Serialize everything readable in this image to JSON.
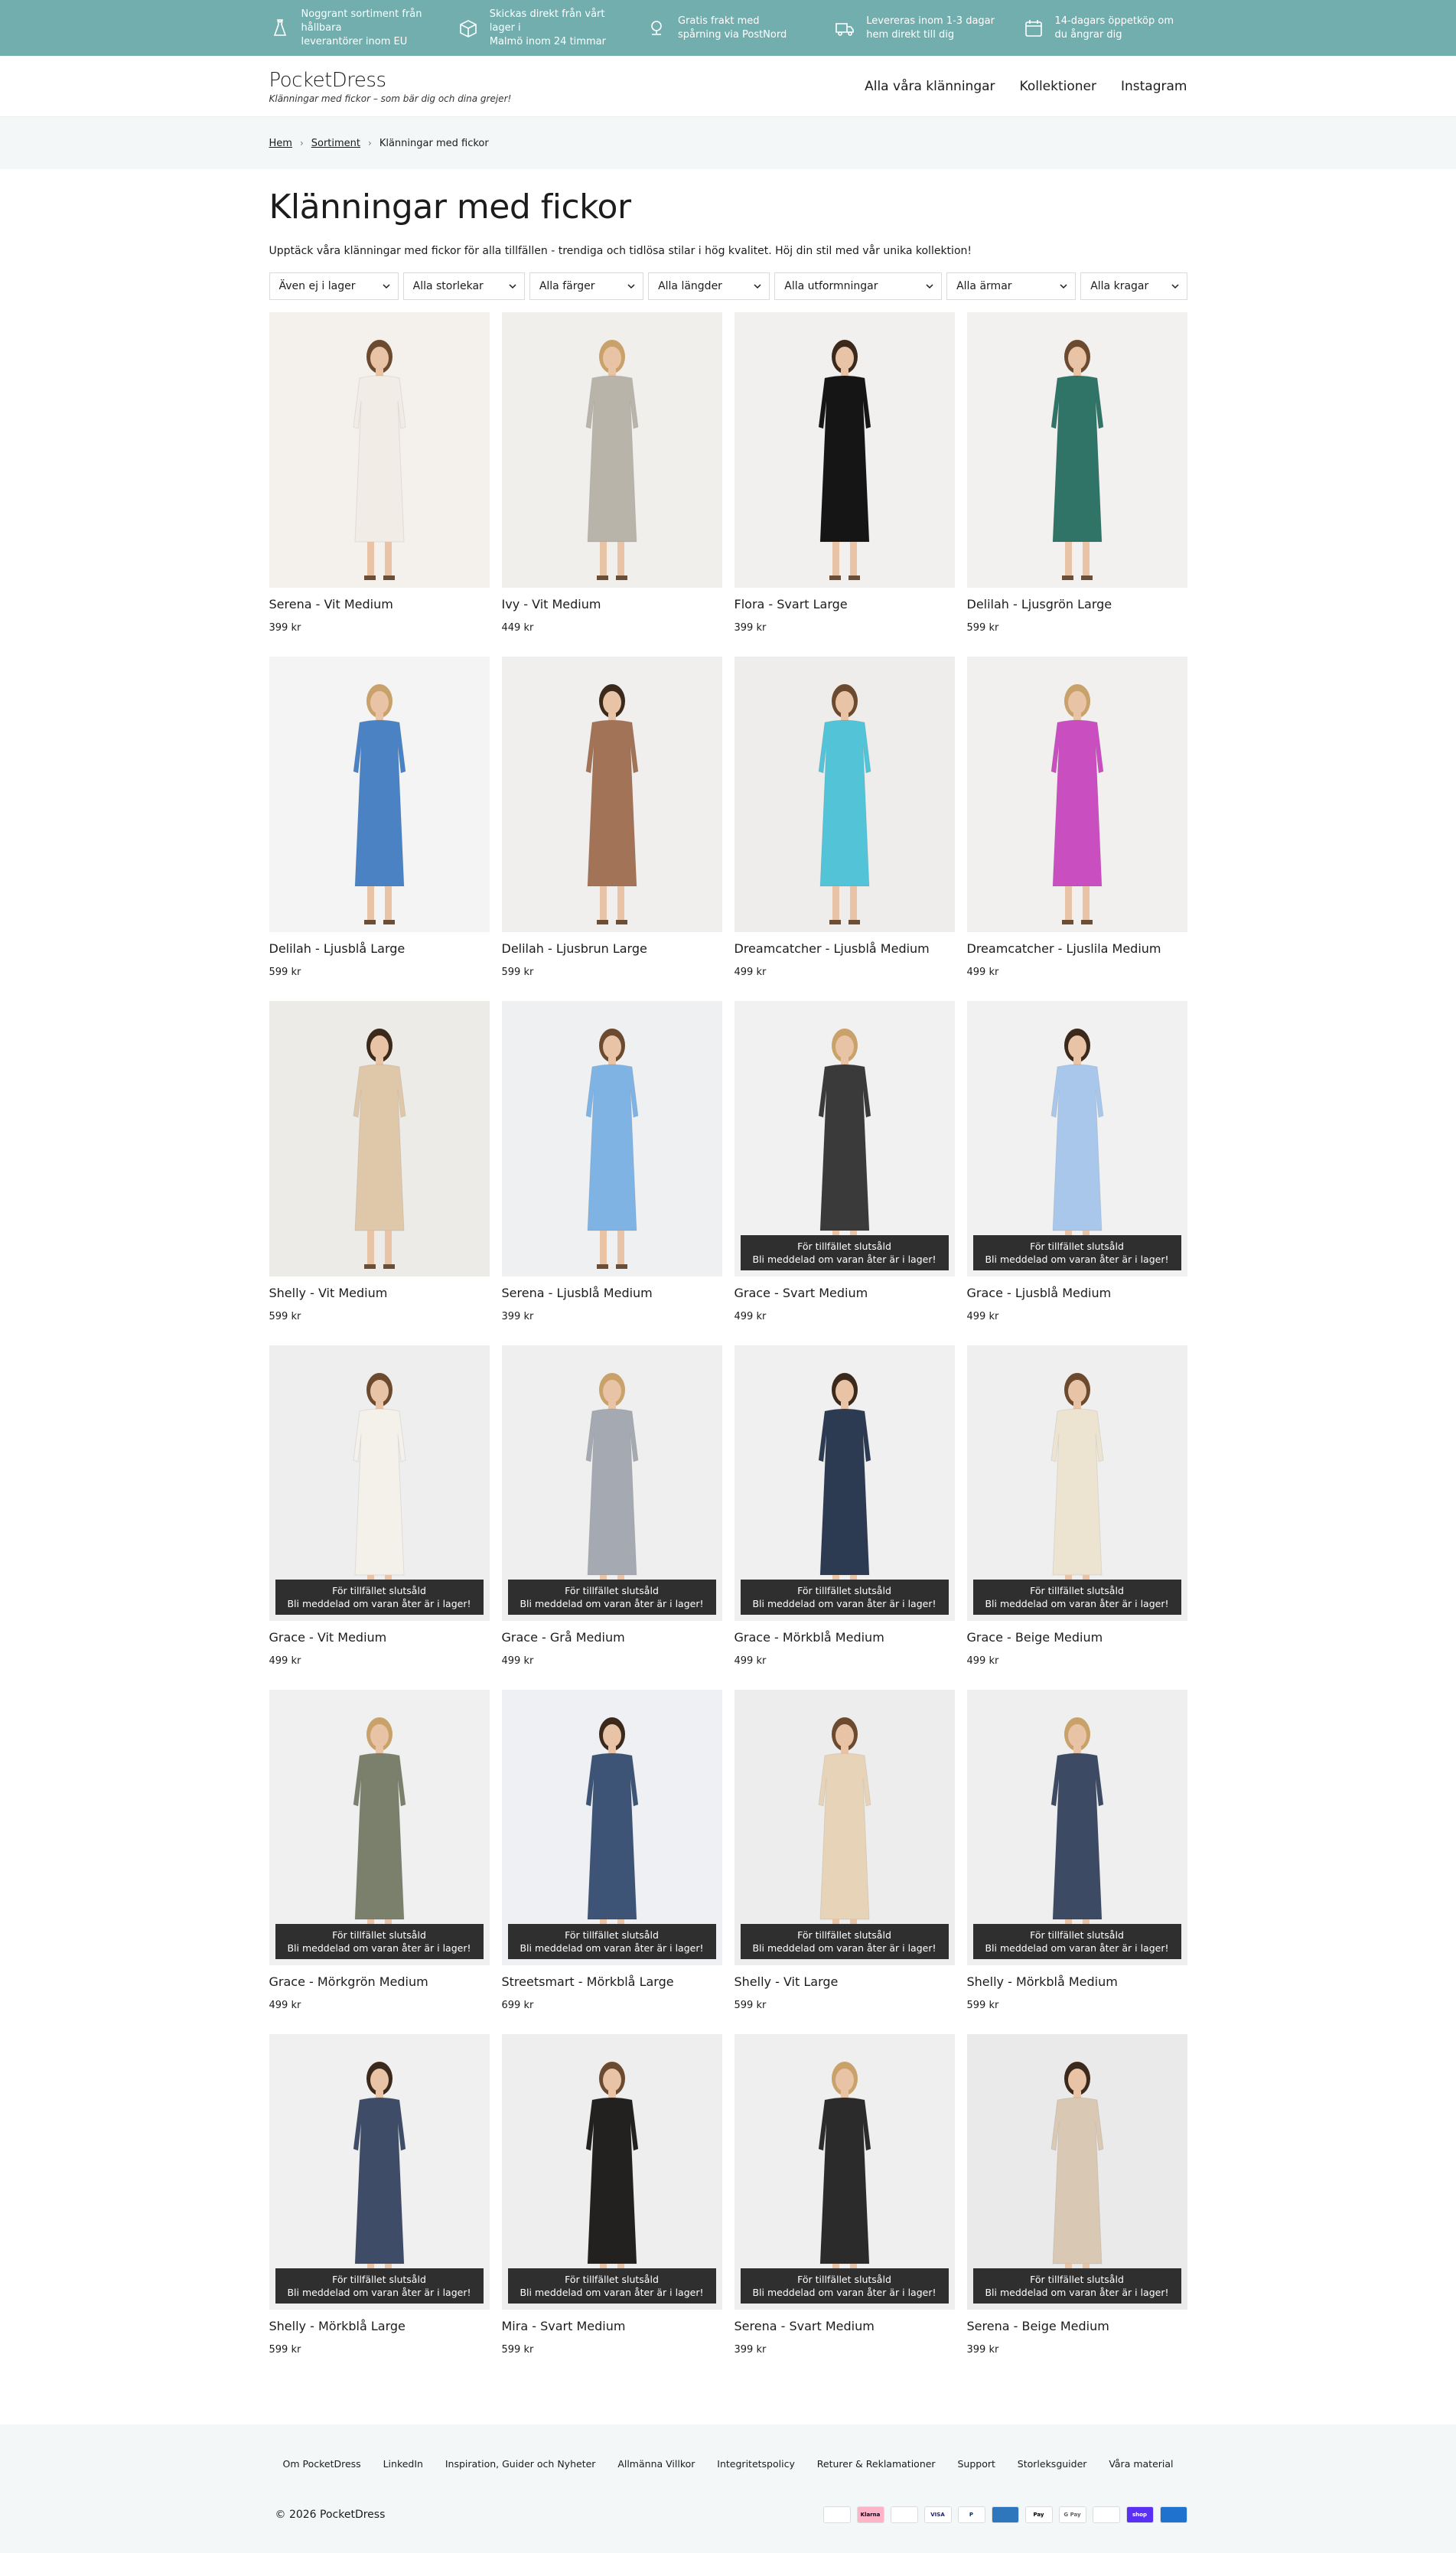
{
  "usps": [
    {
      "icon": "dress-icon",
      "text": "Noggrant sortiment från hållbara\nleverantörer inom EU"
    },
    {
      "icon": "box-icon",
      "text": "Skickas direkt från vårt lager i\nMalmö inom 24 timmar"
    },
    {
      "icon": "location-pin-icon",
      "text": "Gratis frakt med\nspårning via PostNord"
    },
    {
      "icon": "truck-icon",
      "text": "Levereras inom 1-3 dagar\nhem direkt till dig"
    },
    {
      "icon": "calendar-icon",
      "text": "14-dagars öppetköp om\ndu ångrar dig"
    }
  ],
  "header": {
    "logo": "PocketDress",
    "tagline": "Klänningar med fickor – som bär dig och dina grejer!",
    "nav": [
      "Alla våra klänningar",
      "Kollektioner",
      "Instagram"
    ]
  },
  "breadcrumb": [
    "Hem",
    "Sortiment",
    "Klänningar med fickor"
  ],
  "page": {
    "title": "Klänningar med fickor",
    "description": "Upptäck våra klänningar med fickor för alla tillfällen - trendiga och tidlösa stilar i hög kvalitet. Höj din stil med vår unika kollektion!"
  },
  "filters": [
    "Även ej i lager",
    "Alla storlekar",
    "Alla färger",
    "Alla längder",
    "Alla utformningar",
    "Alla ärmar",
    "Alla kragar"
  ],
  "soldout": {
    "line1": "För tillfället slutsåld",
    "line2": "Bli meddelad om varan åter är i lager!"
  },
  "products": [
    {
      "name": "Serena - Vit Medium",
      "price": "399 kr",
      "soldout": false,
      "color": "#f1ede6",
      "bg": "#f4f1ec"
    },
    {
      "name": "Ivy - Vit Medium",
      "price": "449 kr",
      "soldout": false,
      "color": "#b8b4aa",
      "bg": "#f0efec"
    },
    {
      "name": "Flora - Svart Large",
      "price": "399 kr",
      "soldout": false,
      "color": "#151515",
      "bg": "#f2f0ee"
    },
    {
      "name": "Delilah - Ljusgrön Large",
      "price": "599 kr",
      "soldout": false,
      "color": "#2f7467",
      "bg": "#f3f1ef"
    },
    {
      "name": "Delilah - Ljusblå Large",
      "price": "599 kr",
      "soldout": false,
      "color": "#4b82c4",
      "bg": "#f4f4f4"
    },
    {
      "name": "Delilah - Ljusbrun Large",
      "price": "599 kr",
      "soldout": false,
      "color": "#a27356",
      "bg": "#f1efed"
    },
    {
      "name": "Dreamcatcher - Ljusblå Medium",
      "price": "499 kr",
      "soldout": false,
      "color": "#53c3d8",
      "bg": "#efedeb"
    },
    {
      "name": "Dreamcatcher - Ljuslila Medium",
      "price": "499 kr",
      "soldout": false,
      "color": "#c94fc0",
      "bg": "#f1f0ee"
    },
    {
      "name": "Shelly - Vit Medium",
      "price": "599 kr",
      "soldout": false,
      "color": "#dfc7aa",
      "bg": "#ecebe8"
    },
    {
      "name": "Serena - Ljusblå Medium",
      "price": "399 kr",
      "soldout": false,
      "color": "#7fb3e4",
      "bg": "#eef0f2"
    },
    {
      "name": "Grace - Svart Medium",
      "price": "499 kr",
      "soldout": true,
      "color": "#3a3a3a",
      "bg": "#f1f1f1"
    },
    {
      "name": "Grace - Ljusblå Medium",
      "price": "499 kr",
      "soldout": true,
      "color": "#a8c7eb",
      "bg": "#f1f1f1"
    },
    {
      "name": "Grace - Vit Medium",
      "price": "499 kr",
      "soldout": true,
      "color": "#f4f1ea",
      "bg": "#eeeeee"
    },
    {
      "name": "Grace - Grå Medium",
      "price": "499 kr",
      "soldout": true,
      "color": "#a5a9b2",
      "bg": "#efefef"
    },
    {
      "name": "Grace - Mörkblå Medium",
      "price": "499 kr",
      "soldout": true,
      "color": "#2c3a52",
      "bg": "#f0f0f0"
    },
    {
      "name": "Grace - Beige Medium",
      "price": "499 kr",
      "soldout": true,
      "color": "#ede3d1",
      "bg": "#efefef"
    },
    {
      "name": "Grace - Mörkgrön Medium",
      "price": "499 kr",
      "soldout": true,
      "color": "#7a806c",
      "bg": "#f0f0f0"
    },
    {
      "name": "Streetsmart - Mörkblå Large",
      "price": "699 kr",
      "soldout": true,
      "color": "#3d5477",
      "bg": "#eef0f3"
    },
    {
      "name": "Shelly - Vit Large",
      "price": "599 kr",
      "soldout": true,
      "color": "#e6d3b8",
      "bg": "#ededed"
    },
    {
      "name": "Shelly - Mörkblå Medium",
      "price": "599 kr",
      "soldout": true,
      "color": "#3d4a63",
      "bg": "#efefef"
    },
    {
      "name": "Shelly - Mörkblå Large",
      "price": "599 kr",
      "soldout": true,
      "color": "#3f4c67",
      "bg": "#f0f0f0"
    },
    {
      "name": "Mira - Svart Medium",
      "price": "599 kr",
      "soldout": true,
      "color": "#22211f",
      "bg": "#eeeeee"
    },
    {
      "name": "Serena - Svart Medium",
      "price": "399 kr",
      "soldout": true,
      "color": "#2b2b2b",
      "bg": "#efefef"
    },
    {
      "name": "Serena - Beige Medium",
      "price": "399 kr",
      "soldout": true,
      "color": "#d9c8b3",
      "bg": "#eaeaea"
    }
  ],
  "footer": {
    "links": [
      "Om PocketDress",
      "LinkedIn",
      "Inspiration, Guider och Nyheter",
      "Allmänna Villkor",
      "Integritetspolicy",
      "Returer & Reklamationer",
      "Support",
      "Storleksguider",
      "Våra material"
    ],
    "copyright": "© 2026 PocketDress",
    "payments": [
      {
        "name": "",
        "bg": "#ffffff",
        "fg": "#999999"
      },
      {
        "name": "Klarna",
        "bg": "#ffb3c7",
        "fg": "#0b051d"
      },
      {
        "name": "",
        "bg": "#ffffff",
        "fg": "#eb001b"
      },
      {
        "name": "VISA",
        "bg": "#ffffff",
        "fg": "#1a1f71"
      },
      {
        "name": "P",
        "bg": "#ffffff",
        "fg": "#003087"
      },
      {
        "name": "",
        "bg": "#2e77bc",
        "fg": "#ffffff"
      },
      {
        "name": "Pay",
        "bg": "#ffffff",
        "fg": "#000000"
      },
      {
        "name": "G Pay",
        "bg": "#ffffff",
        "fg": "#5f6368"
      },
      {
        "name": "",
        "bg": "#ffffff",
        "fg": "#0099df"
      },
      {
        "name": "shop",
        "bg": "#5a31f4",
        "fg": "#ffffff"
      },
      {
        "name": "",
        "bg": "#1f72cd",
        "fg": "#ffffff"
      }
    ]
  }
}
